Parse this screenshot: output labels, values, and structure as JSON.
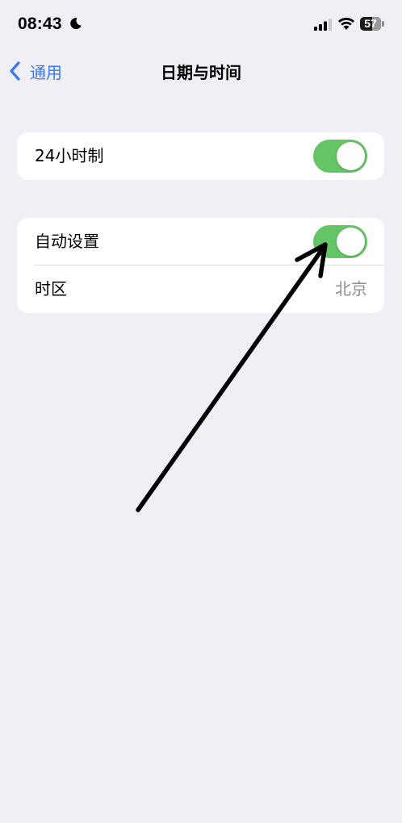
{
  "status_bar": {
    "time": "08:43",
    "battery_level": "57",
    "icons": [
      "moon-icon",
      "signal-icon",
      "wifi-icon",
      "battery-icon"
    ]
  },
  "nav": {
    "back_label": "通用",
    "title": "日期与时间"
  },
  "group_clock": {
    "row_24h": {
      "label": "24小时制",
      "toggle_on": true
    }
  },
  "group_auto": {
    "row_auto": {
      "label": "自动设置",
      "toggle_on": true
    },
    "row_timezone": {
      "label": "时区",
      "value": "北京"
    }
  },
  "colors": {
    "accent": "#3478f6",
    "toggle_on": "#65c466",
    "background": "#f0eff5",
    "secondary_text": "#8e8e93"
  }
}
